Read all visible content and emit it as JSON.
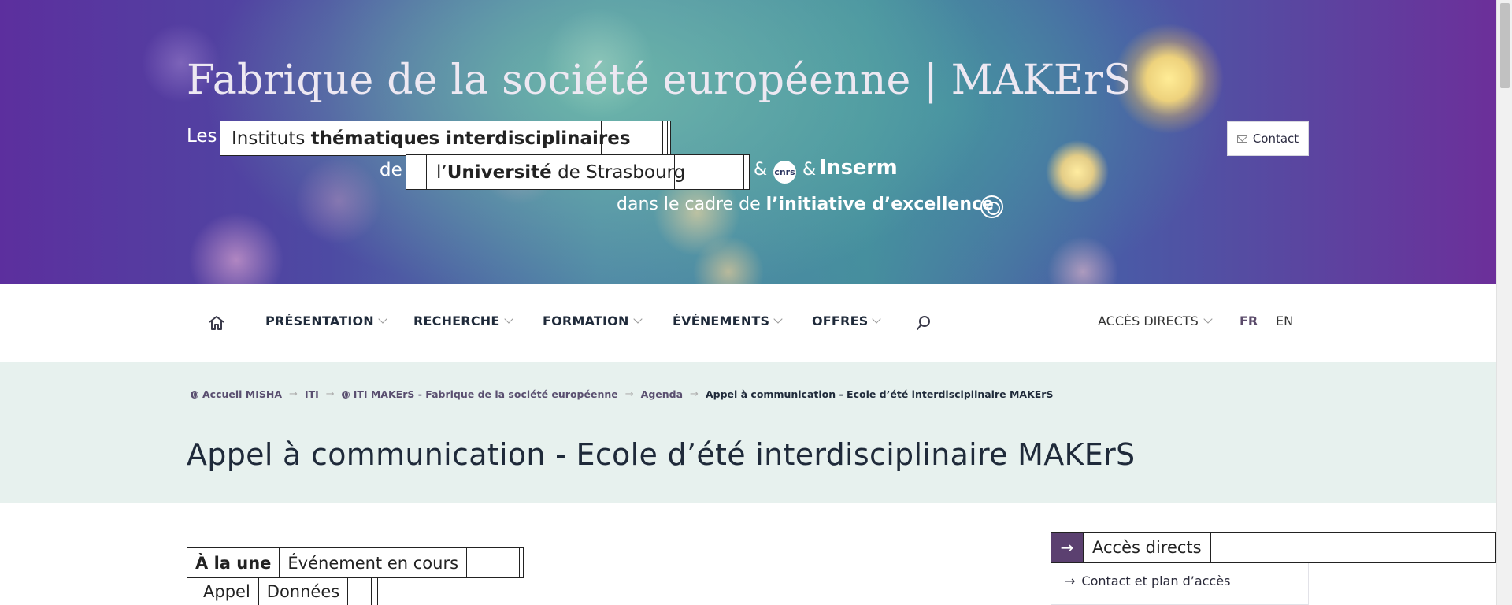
{
  "banner": {
    "title": "Fabrique de la société européenne | MAKErS",
    "les": "Les",
    "instituts": "Instituts",
    "thematiques": "thématiques interdisciplinaires",
    "de": "de",
    "l_apos": "l’",
    "universite": "Université",
    "de_strasbourg": "de Strasbourg",
    "amp": "&",
    "cnrs": "cnrs",
    "inserm": "Inserm",
    "dans_le_cadre": "dans le cadre de",
    "initiative": "l’initiative d’excellence",
    "contact_label": "Contact"
  },
  "nav": {
    "items": [
      {
        "label": "PRÉSENTATION"
      },
      {
        "label": "RECHERCHE"
      },
      {
        "label": "FORMATION"
      },
      {
        "label": "ÉVÉNEMENTS"
      },
      {
        "label": "OFFRES"
      }
    ],
    "acces_directs": "ACCÈS DIRECTS",
    "lang_fr": "FR",
    "lang_en": "EN"
  },
  "breadcrumb": {
    "items": [
      {
        "label": "Accueil MISHA"
      },
      {
        "label": "ITI"
      },
      {
        "label": "ITI MAKErS - Fabrique de la société européenne"
      },
      {
        "label": "Agenda"
      }
    ],
    "current": "Appel à communication - Ecole d’été interdisciplinaire MAKErS"
  },
  "page_title": "Appel à communication - Ecole d’été interdisciplinaire MAKErS",
  "tabs": {
    "row1": [
      "À la une",
      "Événement en cours"
    ],
    "row2": [
      "Appel",
      "Données"
    ]
  },
  "sidebar": {
    "title": "Accès directs",
    "links": [
      "Contact et plan d’accès"
    ]
  },
  "colors": {
    "accent_purple": "#5b4070",
    "band_green": "#e7f1ee",
    "text_dark": "#1f2a3a"
  },
  "icons": [
    "home-icon",
    "search-icon",
    "mail-icon",
    "chevron-down-icon",
    "arrow-right-icon",
    "globe-icon",
    "idex-icon"
  ]
}
